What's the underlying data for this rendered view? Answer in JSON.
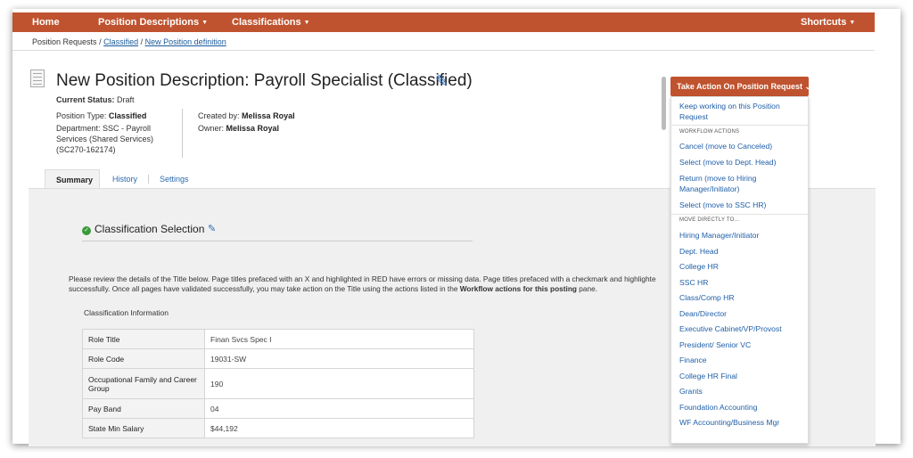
{
  "nav": {
    "home": "Home",
    "position_descriptions": "Position Descriptions",
    "classifications": "Classifications",
    "shortcuts": "Shortcuts",
    "color": "#c0532f"
  },
  "breadcrumb": {
    "root": "Position Requests",
    "sep": "/",
    "classified": "Classified",
    "current": "New Position definition"
  },
  "header": {
    "title": "New Position Description: Payroll Specialist (Classified)",
    "status_label": "Current Status:",
    "status_value": "Draft",
    "position_type_label": "Position Type:",
    "position_type_value": "Classified",
    "department_label": "Department:",
    "department_value": "SSC - Payroll Services (Shared Services) (SC270-162174)",
    "created_by_label": "Created by:",
    "created_by_value": "Melissa Royal",
    "owner_label": "Owner:",
    "owner_value": "Melissa Royal"
  },
  "tabs": [
    {
      "label": "Summary",
      "active": true
    },
    {
      "label": "History",
      "active": false
    },
    {
      "label": "Settings",
      "active": false
    }
  ],
  "section": {
    "title": "Classification Selection",
    "instructions_1": "Please review the details of the Title below.  Page titles prefaced with an X and highlighted in RED have errors or missing data.  Page titles prefaced with a checkmark and highlighte",
    "instructions_2a": "successfully.  Once all pages have validated successfully, you may take action on the Title using the actions listed in the ",
    "instructions_2b": "Workflow actions for this posting",
    "instructions_2c": " pane.",
    "info_heading": "Classification Information"
  },
  "info_table": [
    {
      "key": "Role Title",
      "value": "Finan Svcs Spec I"
    },
    {
      "key": "Role Code",
      "value": "19031-SW"
    },
    {
      "key": "Occupational Family and Career Group",
      "value": "190"
    },
    {
      "key": "Pay Band",
      "value": "04"
    },
    {
      "key": "State Min Salary",
      "value": "$44,192"
    }
  ],
  "action": {
    "button_label": "Take Action On Position Request",
    "keep_working": "Keep working on this Position Request",
    "workflow_header": "WORKFLOW ACTIONS",
    "workflow_items": [
      "Cancel (move to Canceled)",
      "Select (move to Dept. Head)",
      "Return (move to Hiring Manager/Initiator)",
      "Select (move to SSC HR)"
    ],
    "direct_header": "MOVE DIRECTLY TO...",
    "direct_items": [
      "Hiring Manager/Initiator",
      "Dept. Head",
      "College HR",
      "SSC HR",
      "Class/Comp HR",
      "Dean/Director",
      "Executive Cabinet/VP/Provost",
      "President/ Senior VC",
      "Finance",
      "College HR Final",
      "Grants",
      "Foundation Accounting",
      "WF Accounting/Business Mgr"
    ]
  }
}
